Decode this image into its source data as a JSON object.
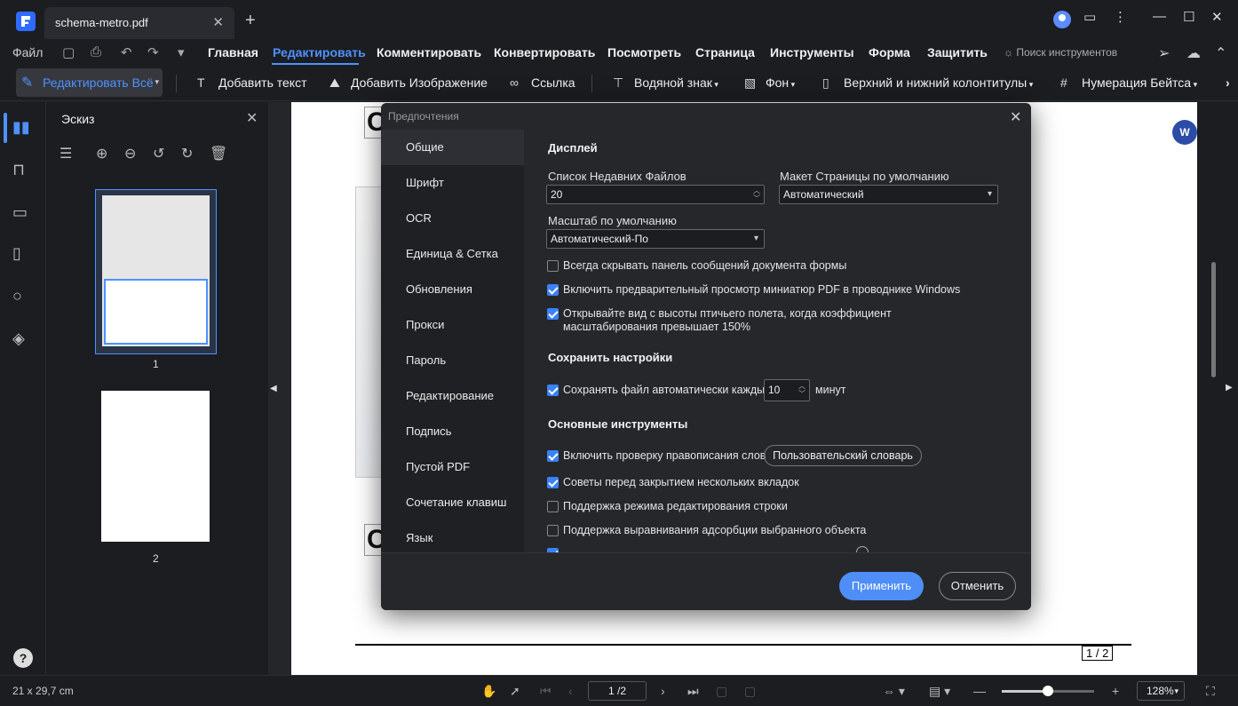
{
  "window": {
    "tab_title": "schema-metro.pdf",
    "tab_close": "✕",
    "new_tab": "+",
    "minimize": "—",
    "maximize": "☐",
    "close": "✕",
    "more": "⋮"
  },
  "menu": {
    "file": "Файл",
    "items": [
      "Главная",
      "Редактировать",
      "Комментировать",
      "Конвертировать",
      "Посмотреть",
      "Страница",
      "Инструменты",
      "Форма",
      "Защитить"
    ],
    "active": "Редактировать",
    "search_tools": "Поиск инструментов"
  },
  "toolbar": {
    "edit_all": "Редактировать Всё",
    "add_text": "Добавить текст",
    "add_image": "Добавить Изображение",
    "link": "Ссылка",
    "watermark": "Водяной знак",
    "background": "Фон",
    "header_footer": "Верхний и нижний колонтитулы",
    "bates": "Нумерация Бейтса"
  },
  "thumbnails": {
    "title": "Эскиз",
    "page1": "1",
    "page2": "2"
  },
  "document": {
    "heading": "C",
    "page_indicator": "1 / 2",
    "word_badge": "W"
  },
  "status": {
    "page_size": "21 x 29,7 cm",
    "page_input": "1 /2",
    "zoom": "128%",
    "zoom_fraction": 0.5
  },
  "dialog": {
    "title": "Предпочтения",
    "nav": [
      "Общие",
      "Шрифт",
      "OCR",
      "Единица & Сетка",
      "Обновления",
      "Прокси",
      "Пароль",
      "Редактирование",
      "Подпись",
      "Пустой PDF",
      "Сочетание клавиш",
      "Язык"
    ],
    "active_nav": "Общие",
    "display": {
      "title": "Дисплей",
      "recent_files_label": "Список Недавних Файлов",
      "recent_files_value": "20",
      "page_layout_label": "Макет Страницы по умолчанию",
      "page_layout_value": "Автоматический",
      "zoom_label": "Масштаб по умолчанию",
      "zoom_value": "Автоматический-По"
    },
    "checkboxes_display": [
      {
        "label": "Всегда скрывать панель сообщений документа формы",
        "checked": false
      },
      {
        "label": "Включить предварительный просмотр миниатюр PDF в проводнике Windows",
        "checked": true
      },
      {
        "label": "Открывайте вид с высоты птичьего полета, когда коэффициент масштабирования превышает 150%",
        "checked": true
      }
    ],
    "save": {
      "title": "Сохранить настройки",
      "autosave_label": "Сохранять файл автоматически каждые",
      "autosave_value": "10",
      "autosave_unit": "минут"
    },
    "tools": {
      "title": "Основные инструменты",
      "spellcheck": "Включить проверку правописания слов",
      "dictionary_button": "Пользовательский словарь",
      "tips_close_tabs": "Советы перед закрытием нескольких вкладок",
      "line_edit": "Поддержка режима редактирования строки",
      "snap_align": "Поддержка выравнивания адсорбции выбранного объекта"
    },
    "apply": "Применить",
    "cancel": "Отменить"
  }
}
